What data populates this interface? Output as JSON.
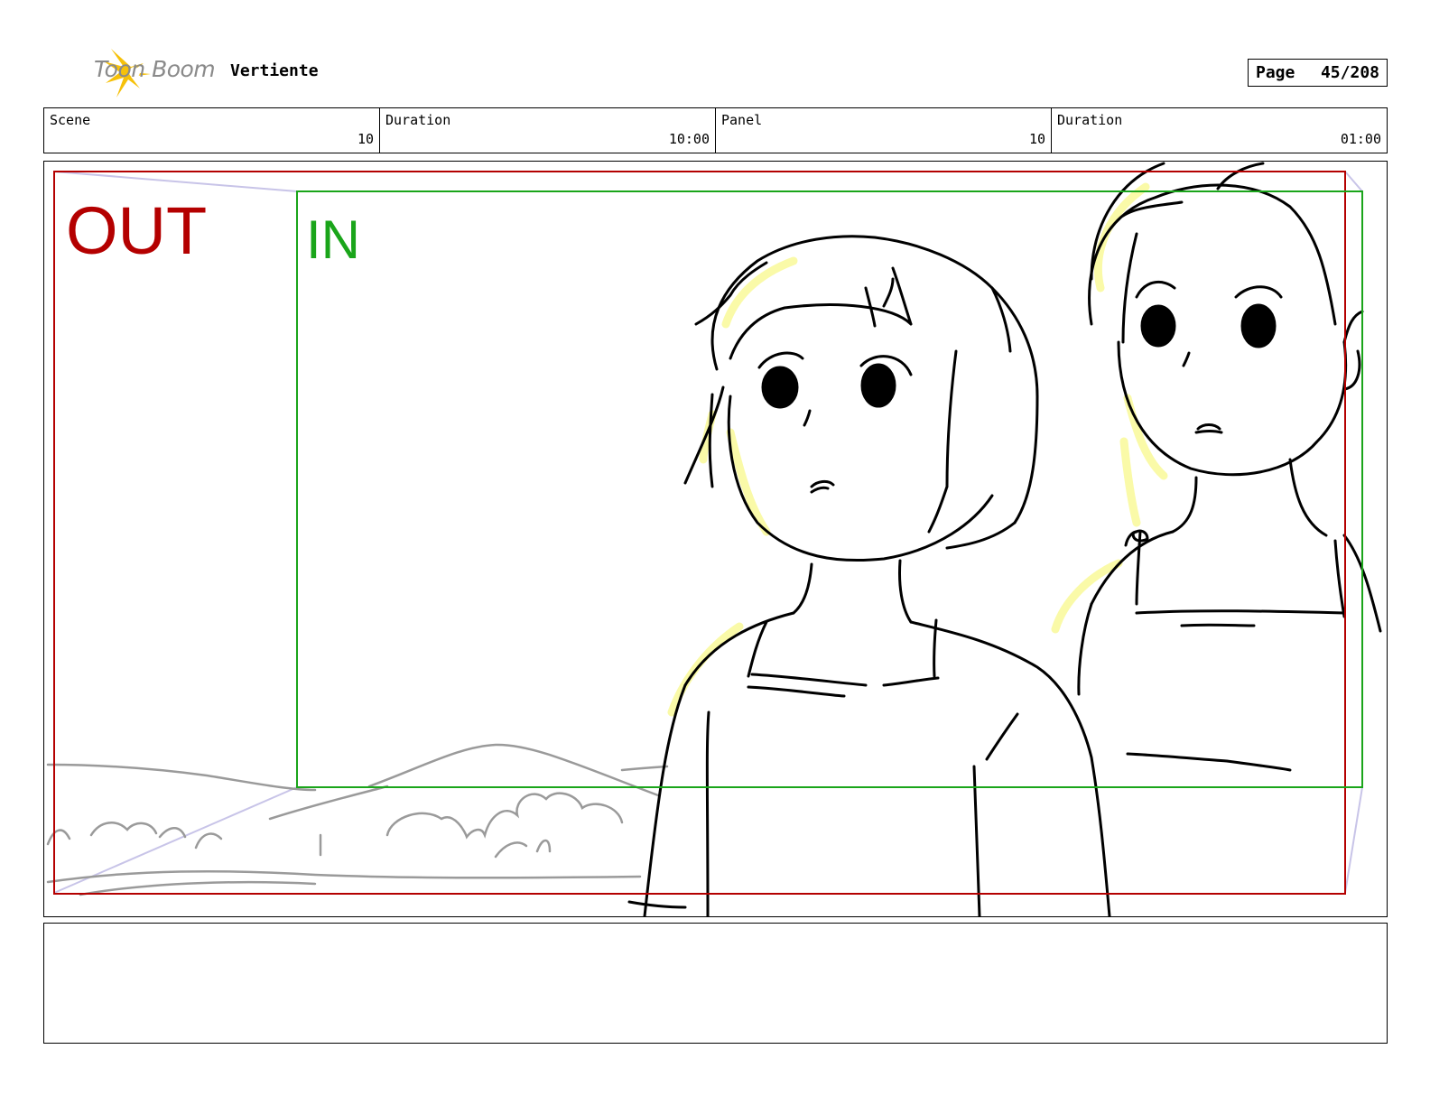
{
  "header": {
    "logo_text": "Toon Boom",
    "project_title": "Vertiente",
    "page_label": "Page",
    "page_number": "45/208"
  },
  "info": [
    {
      "label": "Scene",
      "value": "10"
    },
    {
      "label": "Duration",
      "value": "10:00"
    },
    {
      "label": "Panel",
      "value": "10"
    },
    {
      "label": "Duration",
      "value": "01:00"
    }
  ],
  "panel": {
    "out_label": "OUT",
    "in_label": "IN"
  },
  "icons": {
    "logo": "toon-boom-starburst-icon"
  },
  "colors": {
    "out_frame": "#b40000",
    "in_frame": "#1aa51a",
    "camera_guide": "#c8c4e8",
    "highlight": "#fafaa8",
    "background_sketch": "#9a9a9a"
  }
}
